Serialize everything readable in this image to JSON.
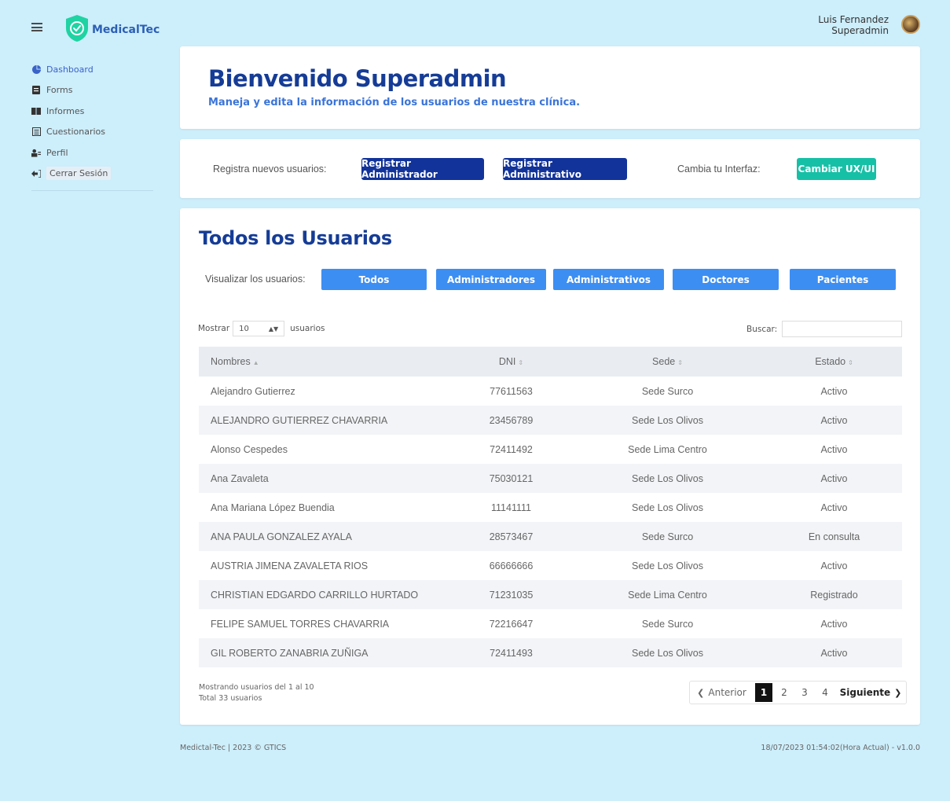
{
  "header": {
    "app_name": "MedicalTec",
    "user_name": "Luis Fernandez",
    "user_role": "Superadmin"
  },
  "sidebar": {
    "items": [
      {
        "label": "Dashboard",
        "icon": "pie-chart-icon"
      },
      {
        "label": "Forms",
        "icon": "form-icon"
      },
      {
        "label": "Informes",
        "icon": "book-icon"
      },
      {
        "label": "Cuestionarios",
        "icon": "list-icon"
      },
      {
        "label": "Perfil",
        "icon": "users-icon"
      },
      {
        "label": "Cerrar Sesión",
        "icon": "logout-icon"
      }
    ]
  },
  "welcome": {
    "title": "Bienvenido Superadmin",
    "subtitle": "Maneja y edita la información de los usuarios de nuestra clínica."
  },
  "actions": {
    "register_label": "Registra nuevos usuarios:",
    "btn_admin": "Registrar Administrador",
    "btn_administrativo": "Registrar Administrativo",
    "ux_label": "Cambia tu Interfaz:",
    "btn_ux": "Cambiar UX/UI"
  },
  "users": {
    "title": "Todos los Usuarios",
    "filter_label": "Visualizar los usuarios:",
    "filters": [
      "Todos",
      "Administradores",
      "Administrativos",
      "Doctores",
      "Pacientes"
    ],
    "show_prefix": "Mostrar",
    "show_value": "10",
    "show_suffix": "usuarios",
    "search_label": "Buscar:",
    "search_value": "",
    "columns": [
      "Nombres",
      "DNI",
      "Sede",
      "Estado"
    ],
    "rows": [
      [
        "Alejandro Gutierrez",
        "77611563",
        "Sede Surco",
        "Activo"
      ],
      [
        "ALEJANDRO GUTIERREZ CHAVARRIA",
        "23456789",
        "Sede Los Olivos",
        "Activo"
      ],
      [
        "Alonso Cespedes",
        "72411492",
        "Sede Lima Centro",
        "Activo"
      ],
      [
        "Ana Zavaleta",
        "75030121",
        "Sede Los Olivos",
        "Activo"
      ],
      [
        "Ana Mariana López Buendia",
        "11141111",
        "Sede Los Olivos",
        "Activo"
      ],
      [
        "ANA PAULA GONZALEZ AYALA",
        "28573467",
        "Sede Surco",
        "En consulta"
      ],
      [
        "AUSTRIA JIMENA ZAVALETA RIOS",
        "66666666",
        "Sede Los Olivos",
        "Activo"
      ],
      [
        "CHRISTIAN EDGARDO CARRILLO HURTADO",
        "71231035",
        "Sede Lima Centro",
        "Registrado"
      ],
      [
        "FELIPE SAMUEL TORRES CHAVARRIA",
        "72216647",
        "Sede Surco",
        "Activo"
      ],
      [
        "GIL ROBERTO ZANABRIA ZUÑIGA",
        "72411493",
        "Sede Los Olivos",
        "Activo"
      ]
    ],
    "info_line1": "Mostrando usuarios del 1 al 10",
    "info_line2": "Total 33 usuarios",
    "pagination": {
      "prev": "Anterior",
      "pages": [
        "1",
        "2",
        "3",
        "4"
      ],
      "active_page": "1",
      "next": "Siguiente"
    }
  },
  "footer": {
    "left": "Medictal-Tec | 2023 © GTICS",
    "right": "18/07/2023 01:54:02(Hora Actual) - v1.0.0"
  },
  "colors": {
    "background": "#cdeefb",
    "primary_dark": "#12339a",
    "filter_blue": "#3d8ef2",
    "teal": "#16c0a6",
    "title_blue": "#153c96"
  }
}
